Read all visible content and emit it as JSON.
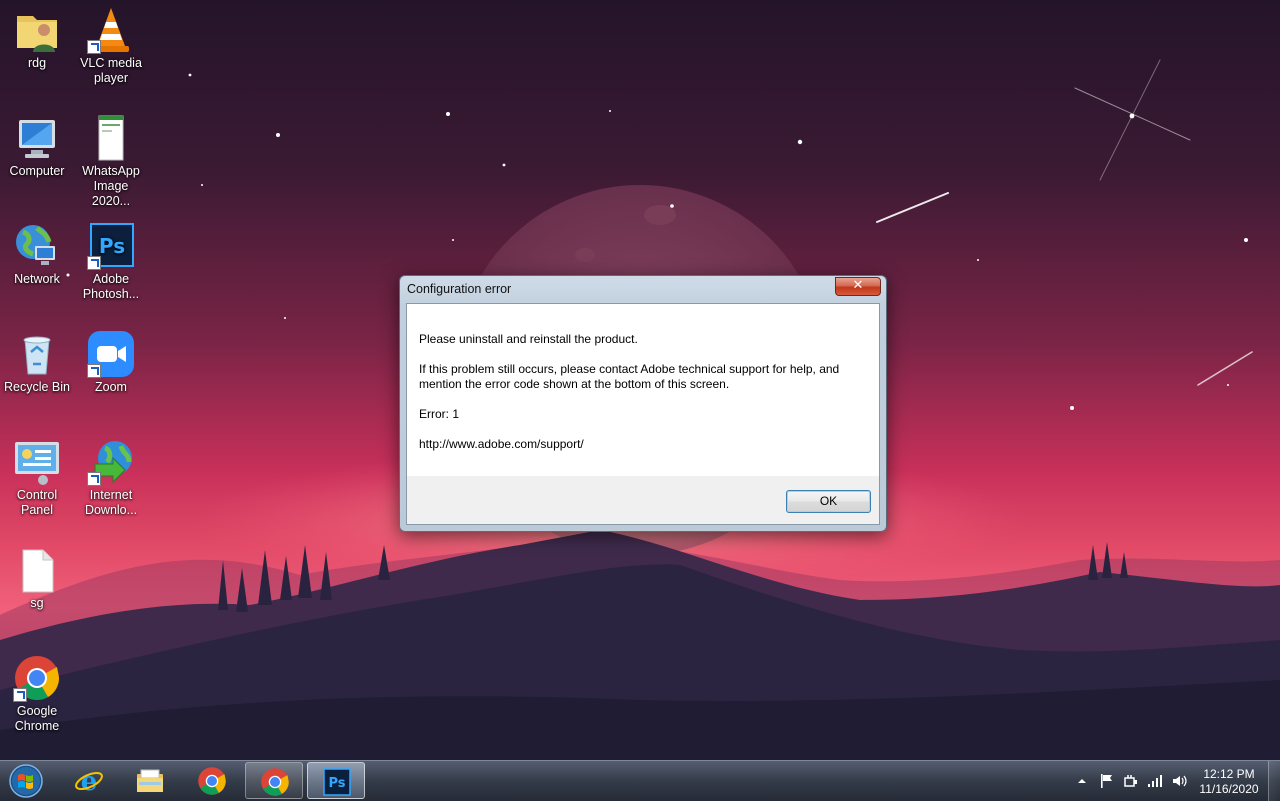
{
  "desktop": {
    "icons": [
      {
        "label": "rdg",
        "icon": "user-folder-icon",
        "shortcut": false
      },
      {
        "label": "VLC media player",
        "icon": "vlc-cone-icon",
        "shortcut": true
      },
      {
        "label": "Computer",
        "icon": "computer-icon",
        "shortcut": false
      },
      {
        "label": "WhatsApp Image 2020...",
        "icon": "image-file-icon",
        "shortcut": false
      },
      {
        "label": "Network",
        "icon": "network-globe-icon",
        "shortcut": false
      },
      {
        "label": "Adobe Photosh...",
        "icon": "photoshop-icon",
        "shortcut": true
      },
      {
        "label": "Recycle Bin",
        "icon": "recycle-bin-icon",
        "shortcut": false
      },
      {
        "label": "Zoom",
        "icon": "zoom-camera-icon",
        "shortcut": true
      },
      {
        "label": "Control Panel",
        "icon": "control-panel-icon",
        "shortcut": false
      },
      {
        "label": "Internet Downlo...",
        "icon": "internet-download-manager-icon",
        "shortcut": true
      },
      {
        "label": "sg",
        "icon": "blank-document-icon",
        "shortcut": false
      },
      {
        "label": "Google Chrome",
        "icon": "chrome-icon",
        "shortcut": true
      }
    ]
  },
  "dialog": {
    "title": "Configuration error",
    "close_label": "✕",
    "message_line1": "Please uninstall and reinstall the product.",
    "message_line2": "If this problem still occurs, please contact Adobe technical support for help, and mention the error code shown at the bottom of this screen.",
    "error_code": "Error: 1",
    "support_url": "http://www.adobe.com/support/",
    "ok_label": "OK"
  },
  "taskbar": {
    "start_icon": "windows-start-orb-icon",
    "apps": [
      {
        "name": "Internet Explorer",
        "icon": "internet-explorer-icon",
        "state": "pinned"
      },
      {
        "name": "Windows Explorer",
        "icon": "file-explorer-icon",
        "state": "pinned"
      },
      {
        "name": "Google Chrome",
        "icon": "chrome-icon",
        "state": "pinned"
      },
      {
        "name": "Google Chrome",
        "icon": "chrome-icon",
        "state": "running"
      },
      {
        "name": "Adobe Photoshop",
        "icon": "photoshop-icon",
        "state": "active"
      }
    ],
    "tray_icons": [
      "show-hidden-icons-arrow",
      "action-center-flag-icon",
      "power-plug-icon",
      "network-signal-icon",
      "volume-icon"
    ],
    "clock": {
      "time": "12:12 PM",
      "date": "11/16/2020"
    }
  },
  "colors": {
    "dialog_frame": "#c2d0de",
    "close_button": "#c2371a",
    "ok_border": "#3c7fb1",
    "taskbar": "#28303e"
  }
}
